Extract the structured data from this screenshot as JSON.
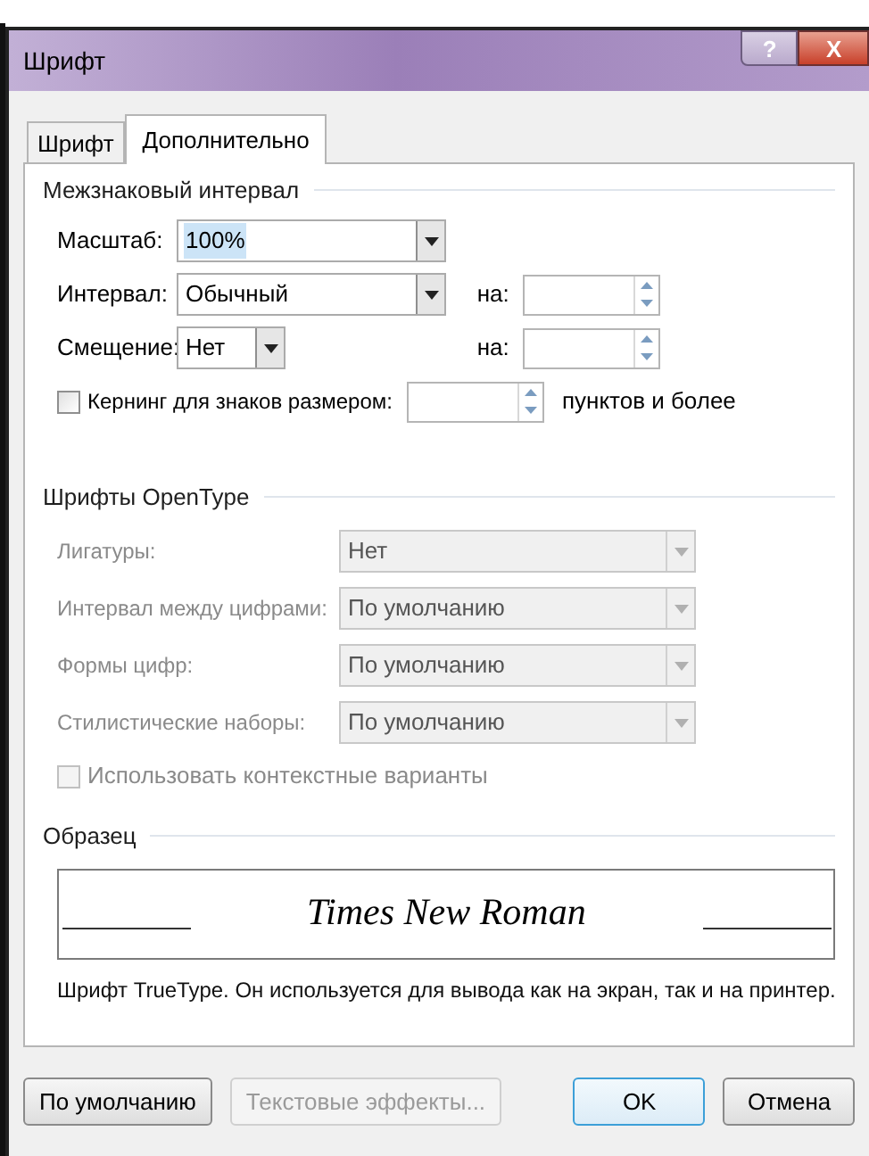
{
  "window": {
    "title": "Шрифт",
    "help_button": "?",
    "close_button": "X"
  },
  "tabs": [
    {
      "label": "Шрифт",
      "selected": false
    },
    {
      "label": "Дополнительно",
      "selected": true
    }
  ],
  "spacing": {
    "title": "Межзнаковый интервал",
    "rows": [
      {
        "label": "Масштаб:",
        "value": "100%",
        "value_selected": true
      },
      {
        "label": "Интервал:",
        "value": "Обычный",
        "value_selected": false,
        "by_label": "на:"
      },
      {
        "label": "Смещение:",
        "value": "Нет",
        "value_selected": false,
        "by_label": "на:"
      }
    ],
    "kerning": {
      "label": "Кернинг для знаков размером:",
      "checked": false,
      "suffix": "пунктов и более"
    }
  },
  "opentype": {
    "title": "Шрифты OpenType",
    "disabled": true,
    "rows": [
      {
        "label": "Лигатуры:",
        "value": "Нет"
      },
      {
        "label": "Интервал между цифрами:",
        "value": "По умолчанию"
      },
      {
        "label": "Формы цифр:",
        "value": "По умолчанию"
      },
      {
        "label": "Стилистические наборы:",
        "value": "По умолчанию"
      }
    ],
    "checkbox": {
      "label": "Использовать контекстные варианты",
      "checked": false
    }
  },
  "sample": {
    "title": "Образец",
    "preview": "Times New Roman",
    "note": "Шрифт TrueType. Он используется для вывода как на экран, так и на принтер."
  },
  "buttons": [
    {
      "label": "По умолчанию",
      "disabled": false,
      "default": false
    },
    {
      "label": "Текстовые эффекты...",
      "disabled": true,
      "default": false
    },
    {
      "label": "OK",
      "disabled": false,
      "default": true
    },
    {
      "label": "Отмена",
      "disabled": false,
      "default": false
    }
  ]
}
